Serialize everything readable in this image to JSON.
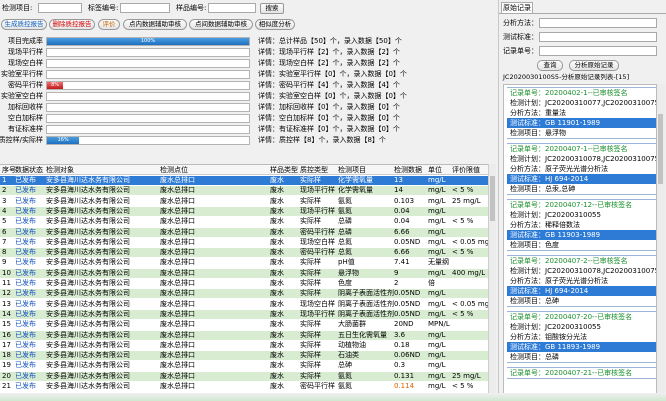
{
  "search": {
    "item_label": "检测项目:",
    "tag_label": "标签编号:",
    "sample_label": "样品编号:",
    "search_btn": "搜索"
  },
  "toolbar": {
    "gen_report": "生成质控报告",
    "delete_report": "删除质控报告",
    "evaluate": "评价",
    "prev_assist": "点内数据辅助审核",
    "point_assist": "点间数据辅助审核",
    "point_analysis": "相似度分析"
  },
  "progress": [
    {
      "label": "项目完成率",
      "pct": 100,
      "pct_text": "100%",
      "color": "blue",
      "detail": "详情：总计样品【50】个，录入数据【50】个"
    },
    {
      "label": "现场平行样",
      "pct": 0,
      "pct_text": "",
      "color": "blue",
      "detail": "详情：现场平行样【2】个，录入数据【2】个"
    },
    {
      "label": "现场空白样",
      "pct": 0,
      "pct_text": "",
      "color": "blue",
      "detail": "详情：现场空白样【2】个，录入数据【2】个"
    },
    {
      "label": "实验室平行样",
      "pct": 0,
      "pct_text": "",
      "color": "blue",
      "detail": "详情：实验室平行样【0】个，录入数据【0】个"
    },
    {
      "label": "密码平行样",
      "pct": 8,
      "pct_text": "8%",
      "color": "red",
      "detail": "详情：密码平行样【4】个，录入数据【4】个"
    },
    {
      "label": "实验室空白样",
      "pct": 0,
      "pct_text": "",
      "color": "blue",
      "detail": "详情：实验室空白样【0】个，录入数据【0】个"
    },
    {
      "label": "加标回收样",
      "pct": 0,
      "pct_text": "",
      "color": "blue",
      "detail": "详情：加标回收样【0】个，录入数据【0】个"
    },
    {
      "label": "空白加标样",
      "pct": 0,
      "pct_text": "",
      "color": "blue",
      "detail": "详情：空白加标样【0】个，录入数据【0】个"
    },
    {
      "label": "有证标准样",
      "pct": 0,
      "pct_text": "",
      "color": "blue",
      "detail": "详情：有证标准样【0】个，录入数据【0】个"
    },
    {
      "label": "质控样/实际样",
      "pct": 16,
      "pct_text": "16%",
      "color": "blue",
      "detail": "详情：质控样【8】个，录入数据【8】个"
    }
  ],
  "table": {
    "headers": [
      "序号",
      "数据状态",
      "检测对象",
      "检测点位",
      "样品类型",
      "质控类型",
      "检测项目",
      "检测数据",
      "单位",
      "评价限值"
    ],
    "rows": [
      [
        "1",
        "已发布",
        "安多县海川达水务有限公司",
        "废水总排口",
        "废水",
        "实际样",
        "化学需氧量",
        "13",
        "mg/L",
        ""
      ],
      [
        "2",
        "已发布",
        "安多县海川达水务有限公司",
        "废水总排口",
        "废水",
        "现场平行样",
        "化学需氧量",
        "14",
        "mg/L",
        "< 5 %"
      ],
      [
        "3",
        "已发布",
        "安多县海川达水务有限公司",
        "废水总排口",
        "废水",
        "实际样",
        "氨氮",
        "0.103",
        "mg/L",
        "25 mg/L"
      ],
      [
        "4",
        "已发布",
        "安多县海川达水务有限公司",
        "废水总排口",
        "废水",
        "现场平行样",
        "氨氮",
        "0.04",
        "mg/L",
        ""
      ],
      [
        "5",
        "已发布",
        "安多县海川达水务有限公司",
        "废水总排口",
        "废水",
        "实际样",
        "总磷",
        "0.04",
        "mg/L",
        "< 5 %"
      ],
      [
        "6",
        "已发布",
        "安多县海川达水务有限公司",
        "废水总排口",
        "废水",
        "密码平行样",
        "总磷",
        "6.66",
        "mg/L",
        ""
      ],
      [
        "7",
        "已发布",
        "安多县海川达水务有限公司",
        "废水总排口",
        "废水",
        "现场空白样",
        "总氮",
        "0.05ND",
        "mg/L",
        "< 0.05 mg"
      ],
      [
        "8",
        "已发布",
        "安多县海川达水务有限公司",
        "废水总排口",
        "废水",
        "密码平行样",
        "总氮",
        "6.66",
        "mg/L",
        "< 5 %"
      ],
      [
        "9",
        "已发布",
        "安多县海川达水务有限公司",
        "废水总排口",
        "废水",
        "实际样",
        "pH值",
        "7.41",
        "无量纲",
        ""
      ],
      [
        "10",
        "已发布",
        "安多县海川达水务有限公司",
        "废水总排口",
        "废水",
        "实际样",
        "悬浮物",
        "9",
        "mg/L",
        "400 mg/L"
      ],
      [
        "11",
        "已发布",
        "安多县海川达水务有限公司",
        "废水总排口",
        "废水",
        "实际样",
        "色度",
        "2",
        "倍",
        ""
      ],
      [
        "12",
        "已发布",
        "安多县海川达水务有限公司",
        "废水总排口",
        "废水",
        "实际样",
        "阴离子表面活性剂",
        "0.05ND",
        "mg/L",
        ""
      ],
      [
        "13",
        "已发布",
        "安多县海川达水务有限公司",
        "废水总排口",
        "废水",
        "现场空白样",
        "阴离子表面活性剂",
        "0.05ND",
        "mg/L",
        "< 0.05 mg"
      ],
      [
        "14",
        "已发布",
        "安多县海川达水务有限公司",
        "废水总排口",
        "废水",
        "现场平行样",
        "阴离子表面活性剂",
        "0.05ND",
        "mg/L",
        "< 5 %"
      ],
      [
        "15",
        "已发布",
        "安多县海川达水务有限公司",
        "废水总排口",
        "废水",
        "实际样",
        "大肠菌群",
        "20ND",
        "MPN/L",
        ""
      ],
      [
        "16",
        "已发布",
        "安多县海川达水务有限公司",
        "废水总排口",
        "废水",
        "实际样",
        "五日生化需氧量",
        "3.6",
        "mg/L",
        ""
      ],
      [
        "17",
        "已发布",
        "安多县海川达水务有限公司",
        "废水总排口",
        "废水",
        "实际样",
        "动植物油",
        "0.18",
        "mg/L",
        ""
      ],
      [
        "18",
        "已发布",
        "安多县海川达水务有限公司",
        "废水总排口",
        "废水",
        "实际样",
        "石油类",
        "0.06ND",
        "mg/L",
        ""
      ],
      [
        "19",
        "已发布",
        "安多县海川达水务有限公司",
        "废水总排口",
        "废水",
        "实际样",
        "总砷",
        "0.3",
        "mg/L",
        ""
      ],
      [
        "20",
        "已发布",
        "安多县海川达水务有限公司",
        "废水总排口",
        "废水",
        "实际样",
        "氨氮",
        "0.131",
        "mg/L",
        "25 mg/L"
      ],
      [
        "21",
        "已发布",
        "安多县海川达水务有限公司",
        "废水总排口",
        "废水",
        "密码平行样",
        "氨氮",
        "0.114",
        "mg/L",
        "< 5 %"
      ]
    ]
  },
  "right_panel": {
    "tab": "原始记录",
    "method_label": "分析方法：",
    "standard_label": "测试标准：",
    "record_no_label": "记录单号：",
    "query_btn": "查询",
    "analysis_btn": "分析原始记录",
    "record_header": "JC2020030100S5-分析原始记录列表-[15]",
    "records": [
      {
        "no": "记录单号：20200402-1--已审核签名",
        "plan": "检测计划：JC20200310077,JC202003100755,JC",
        "method": "分析方法：重量法",
        "standard": "测试标准：GB 11901-1989",
        "item": "检测项目：悬浮物"
      },
      {
        "no": "记录单号：20200407-1--已审核签名",
        "plan": "检测计划：JC20200310078,JC202003100755,JC",
        "method": "分析方法：原子荧光光谱分析法",
        "standard": "测试标准：HJ 694-2014",
        "item": "检测项目：总汞,总砷"
      },
      {
        "no": "记录单号：20200407-12--已审核签名",
        "plan": "检测计划：JC20200310055",
        "method": "分析方法：稀释倍数法",
        "standard": "测试标准：GB 11903-1989",
        "item": "检测项目：色度"
      },
      {
        "no": "记录单号：20200407-2--已审核签名",
        "plan": "检测计划：JC20200310078,JC202003100755,JC",
        "method": "分析方法：原子荧光光谱分析法",
        "standard": "测试标准：HJ 694-2014",
        "item": "检测项目：总砷"
      },
      {
        "no": "记录单号：20200407-20--已审核签名",
        "plan": "检测计划：JC20200310055",
        "method": "分析方法：钼酸铵分光法",
        "standard": "测试标准：GB 11893-1989",
        "item": "检测项目：总磷"
      },
      {
        "no": "记录单号：20200407-21--已审核签名",
        "plan": "",
        "method": "",
        "standard": "",
        "item": ""
      }
    ]
  },
  "colors": {
    "selected_row": "#2e7bd6",
    "alt_row": "#d8ecd1",
    "status_text": "#1050c0",
    "accent_green": "#1a8f2a"
  }
}
